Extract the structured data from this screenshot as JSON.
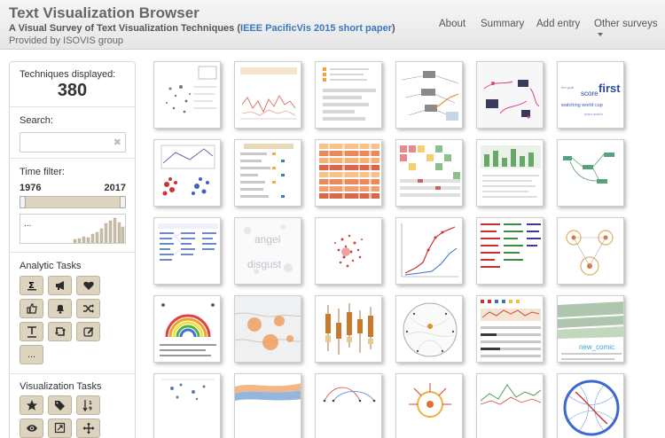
{
  "header": {
    "title": "Text Visualization Browser",
    "subtitle_prefix": "A Visual Survey of Text Visualization Techniques (",
    "subtitle_link": "IEEE PacificVis 2015 short paper",
    "subtitle_suffix": ")",
    "provided_by": "Provided by ISOVIS group",
    "nav": {
      "about": "About",
      "summary": "Summary",
      "add_entry": "Add entry",
      "other_surveys": "Other surveys"
    }
  },
  "sidebar": {
    "techniques_label": "Techniques displayed:",
    "techniques_count": "380",
    "search_label": "Search:",
    "search_value": "",
    "search_clear": "✖",
    "time_label": "Time filter:",
    "year_start": "1976",
    "year_end": "2017",
    "histogram_ellipsis": "...",
    "analytic_label": "Analytic Tasks",
    "analytic_buttons": [
      {
        "icon": "summary-sigma-icon",
        "text": "Σ"
      },
      {
        "icon": "megaphone-icon",
        "text": ""
      },
      {
        "icon": "heart-icon",
        "text": ""
      },
      {
        "icon": "thumbs-up-icon",
        "text": ""
      },
      {
        "icon": "bell-icon",
        "text": ""
      },
      {
        "icon": "shuffle-icon",
        "text": ""
      },
      {
        "icon": "text-format-icon",
        "text": ""
      },
      {
        "icon": "retweet-icon",
        "text": ""
      },
      {
        "icon": "edit-icon",
        "text": ""
      },
      {
        "icon": "more-ellipsis-icon",
        "text": "..."
      }
    ],
    "visualization_label": "Visualization Tasks",
    "visualization_buttons": [
      {
        "icon": "star-icon"
      },
      {
        "icon": "tags-icon"
      },
      {
        "icon": "sort-numeric-icon"
      },
      {
        "icon": "eye-icon"
      },
      {
        "icon": "zoom-in-icon"
      },
      {
        "icon": "move-arrows-icon"
      }
    ]
  },
  "gallery": {
    "rows": 5,
    "columns": 6,
    "thumbnail_texts": {
      "first": "first",
      "score": "score",
      "watching_world_cup": "watching world cup",
      "angel": "angel",
      "disgust": "disgust",
      "new_comic": "new_comic"
    }
  }
}
